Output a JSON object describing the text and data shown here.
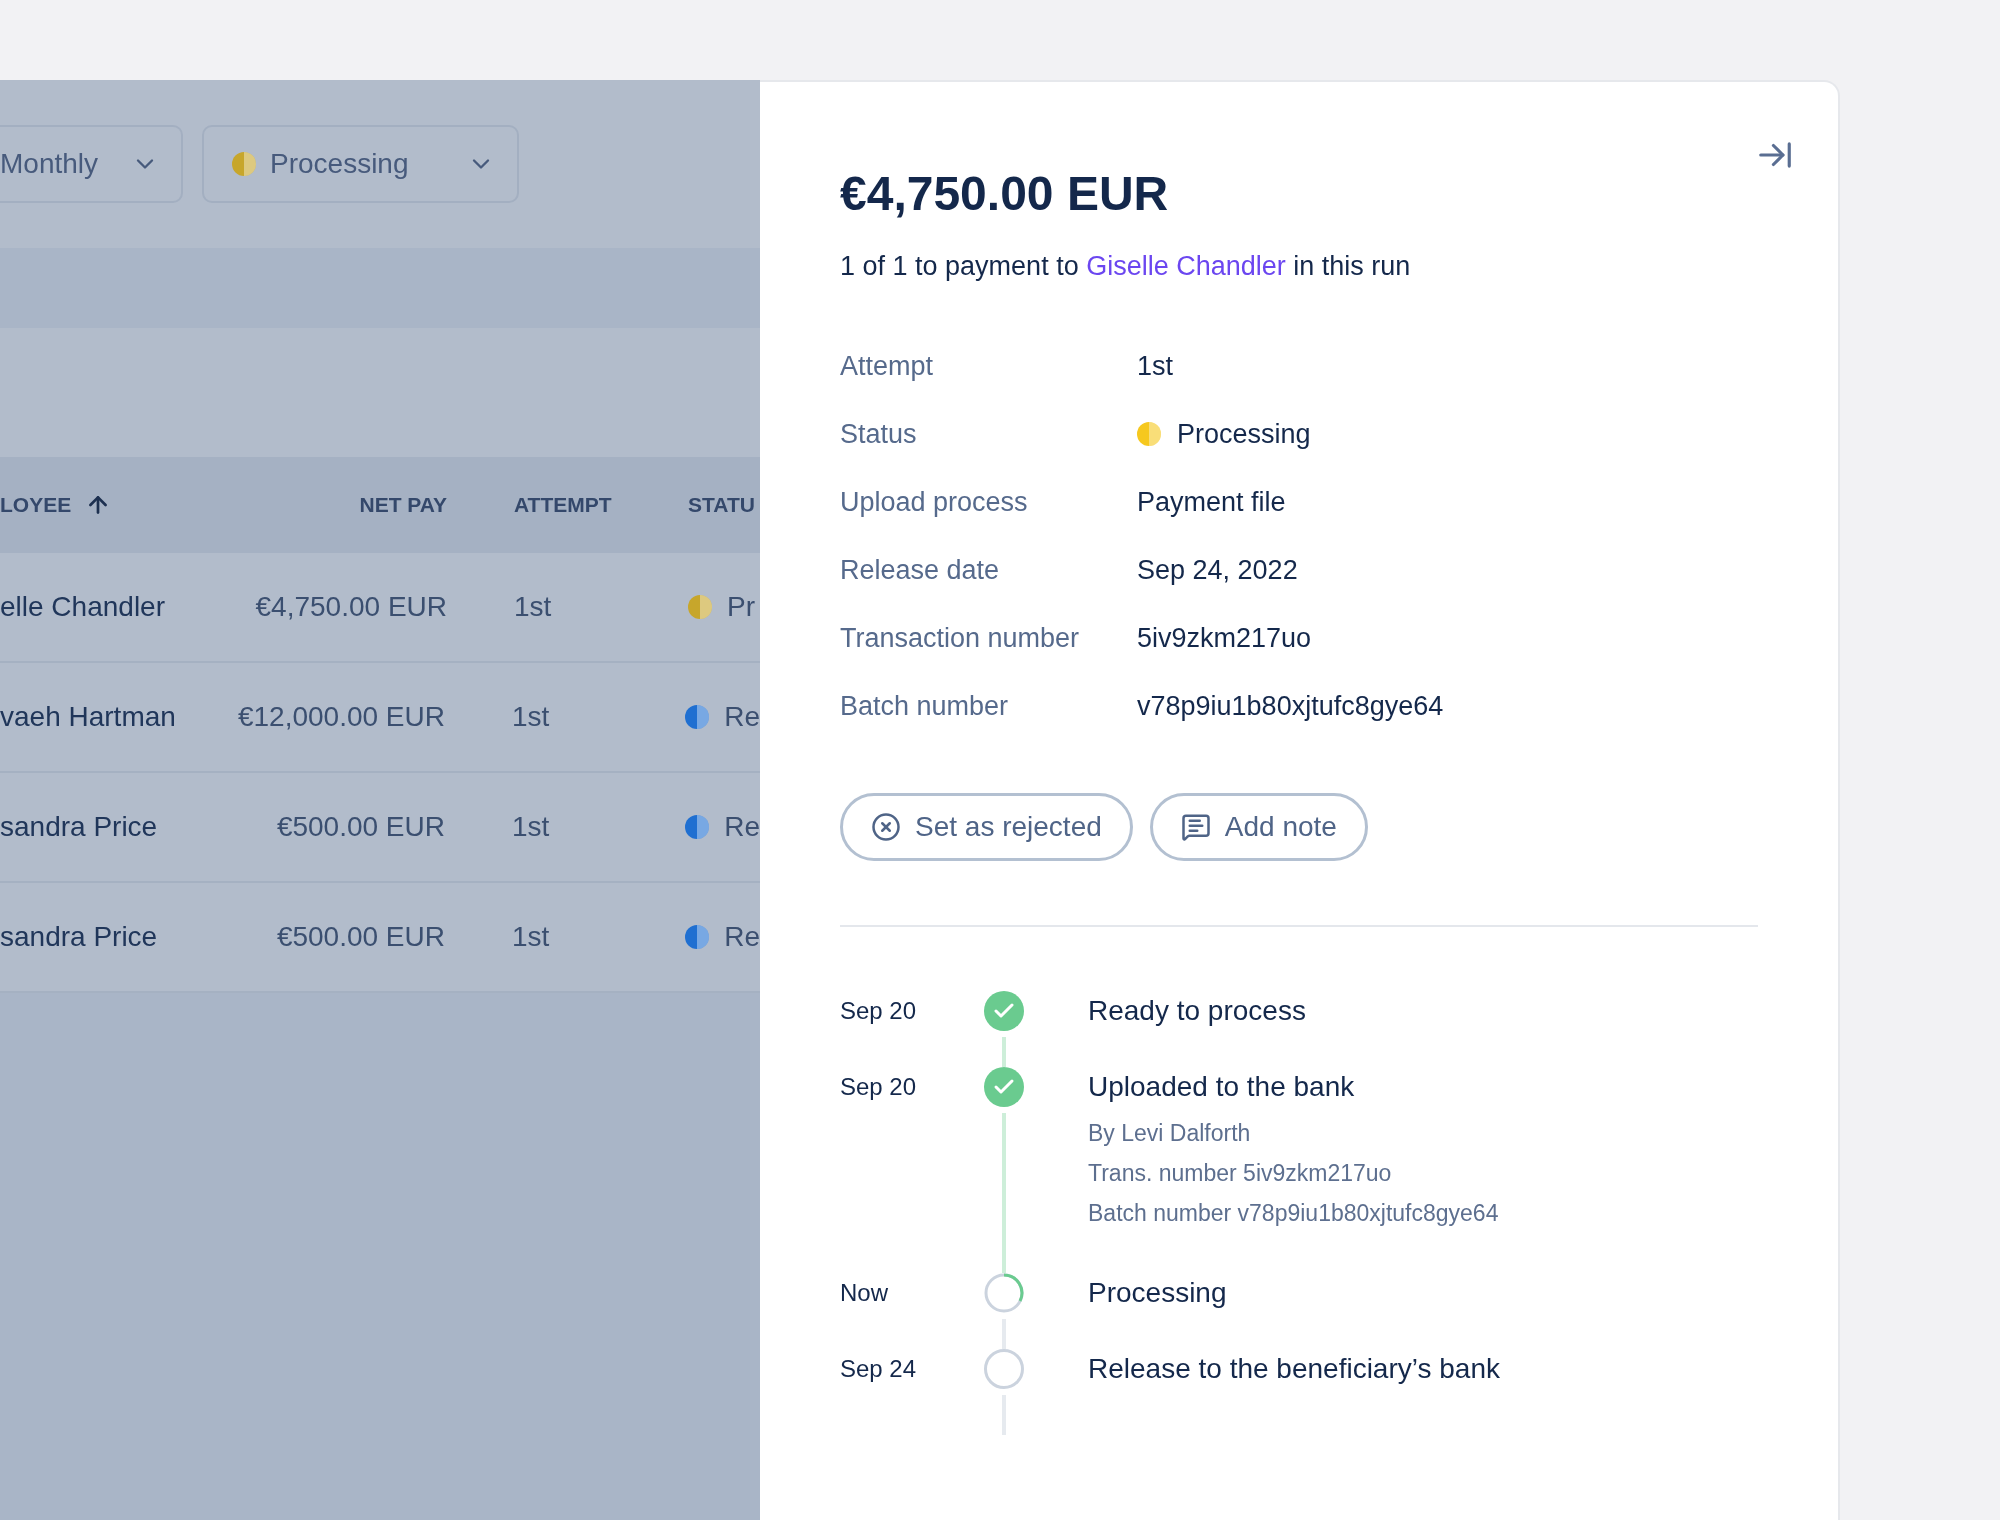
{
  "filters": [
    {
      "kind": "plain",
      "label": "Monthly"
    },
    {
      "kind": "status",
      "label": "Processing",
      "color": "#c7a62b"
    }
  ],
  "table": {
    "columns": [
      "LOYEE",
      "NET PAY",
      "ATTEMPT",
      "STATU"
    ],
    "rows": [
      {
        "employee": "elle Chandler",
        "net_pay": "€4,750.00 EUR",
        "attempt": "1st",
        "status": "Pr",
        "color": "#c7a62b"
      },
      {
        "employee": "vaeh Hartman",
        "net_pay": "€12,000.00 EUR",
        "attempt": "1st",
        "status": "Re",
        "color": "#1f6fd1"
      },
      {
        "employee": "sandra Price",
        "net_pay": "€500.00 EUR",
        "attempt": "1st",
        "status": "Re",
        "color": "#1f6fd1"
      },
      {
        "employee": "sandra Price",
        "net_pay": "€500.00 EUR",
        "attempt": "1st",
        "status": "Re",
        "color": "#1f6fd1"
      }
    ]
  },
  "panel": {
    "amount": "€4,750.00 EUR",
    "subtitle": {
      "before": "1 of 1 to payment to",
      "link": "Giselle Chandler",
      "after": "in this run"
    },
    "details": [
      {
        "kind": "text",
        "label": "Attempt",
        "value": "1st"
      },
      {
        "kind": "status",
        "label": "Status",
        "value": "Processing",
        "color": "#f6c81e"
      },
      {
        "kind": "text",
        "label": "Upload process",
        "value": "Payment file"
      },
      {
        "kind": "text",
        "label": "Release date",
        "value": "Sep 24, 2022"
      },
      {
        "kind": "text",
        "label": "Transaction number",
        "value": "5iv9zkm217uo"
      },
      {
        "kind": "text",
        "label": "Batch number",
        "value": "v78p9iu1b80xjtufc8gye64"
      }
    ],
    "buttons": [
      {
        "kind": "reject",
        "label": "Set as rejected"
      },
      {
        "kind": "note",
        "label": "Add note"
      }
    ],
    "timeline": [
      {
        "date": "Sep 20",
        "kind": "done",
        "title": "Ready to process"
      },
      {
        "date": "Sep 20",
        "kind": "done",
        "title": "Uploaded to the bank",
        "details": [
          "By Levi Dalforth",
          "Trans. number 5iv9zkm217uo",
          "Batch number v78p9iu1b80xjtufc8gye64"
        ]
      },
      {
        "date": "Now",
        "kind": "current",
        "title": "Processing"
      },
      {
        "date": "Sep 24",
        "kind": "pending",
        "title": "Release to the beneficiary’s bank"
      }
    ]
  }
}
